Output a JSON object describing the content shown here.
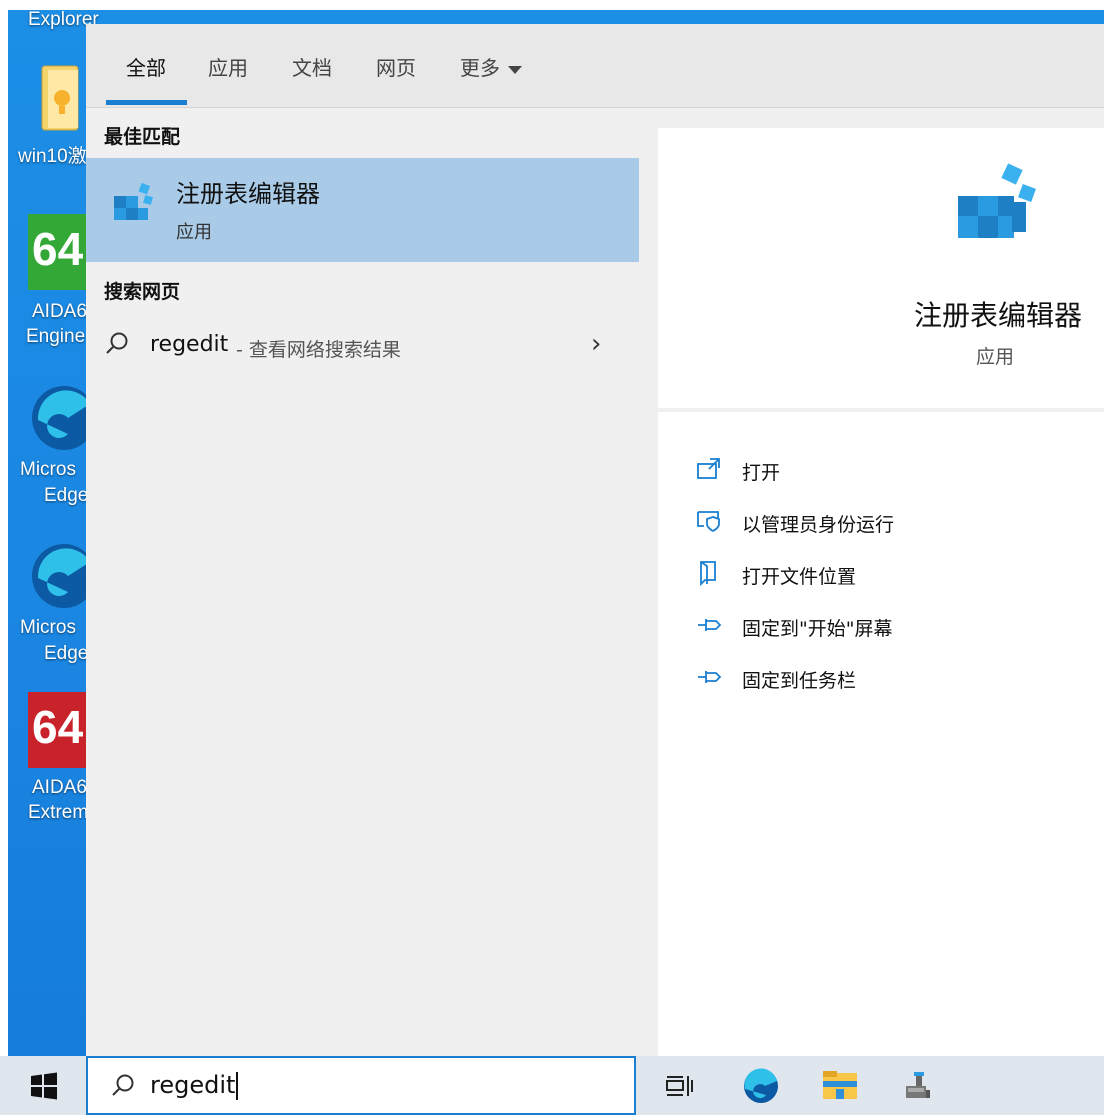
{
  "desktop": {
    "icons": [
      {
        "name": "explorer",
        "label": "Explorer"
      },
      {
        "name": "win10",
        "label": "win10激"
      },
      {
        "name": "aida64-engineer",
        "label_line1": "AIDA6",
        "label_line2": "Engine",
        "badge": "64"
      },
      {
        "name": "edge-1",
        "label_line1": "Micros",
        "label_line2": "Edge"
      },
      {
        "name": "edge-2",
        "label_line1": "Micros",
        "label_line2": "Edge"
      },
      {
        "name": "aida64-extreme",
        "label_line1": "AIDA6",
        "label_line2": "Extrem",
        "badge": "64"
      }
    ]
  },
  "search_panel": {
    "tabs": [
      {
        "label": "全部",
        "active": true
      },
      {
        "label": "应用",
        "active": false
      },
      {
        "label": "文档",
        "active": false
      },
      {
        "label": "网页",
        "active": false
      },
      {
        "label": "更多",
        "active": false
      }
    ],
    "best_match_heading": "最佳匹配",
    "best_match": {
      "title": "注册表编辑器",
      "subtitle": "应用"
    },
    "web_heading": "搜索网页",
    "web_result": {
      "query": "regedit",
      "description": "- 查看网络搜索结果"
    },
    "details": {
      "title": "注册表编辑器",
      "subtitle": "应用",
      "actions": [
        {
          "label": "打开",
          "icon": "open-icon"
        },
        {
          "label": "以管理员身份运行",
          "icon": "run-as-admin-icon"
        },
        {
          "label": "打开文件位置",
          "icon": "file-location-icon"
        },
        {
          "label": "固定到\"开始\"屏幕",
          "icon": "pin-icon"
        },
        {
          "label": "固定到任务栏",
          "icon": "pin-icon"
        }
      ]
    },
    "accent_color": "#1a7fd1",
    "selection_color": "#a9cbe8"
  },
  "taskbar": {
    "search_value": "regedit"
  }
}
